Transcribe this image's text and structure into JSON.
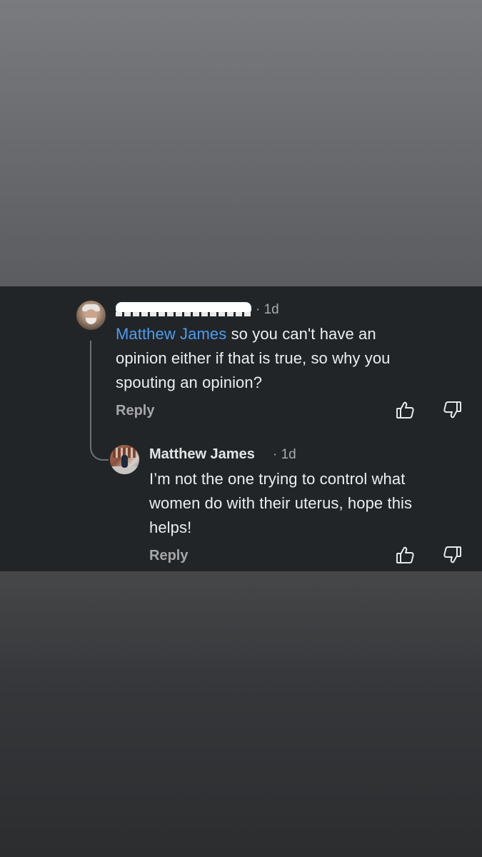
{
  "thread": {
    "comment1": {
      "time": "· 1d",
      "mention": "Matthew James",
      "line1_rest": " so you can't have an",
      "line2": "opinion either if that is true, so why you",
      "line3": "spouting an opinion?",
      "reply_label": "Reply"
    },
    "comment2": {
      "author": "Matthew James",
      "time": "· 1d",
      "line1": "I’m not the one trying to control what",
      "line2": "women do with their uterus, hope this",
      "line3": "helps!",
      "reply_label": "Reply"
    }
  },
  "icons": {
    "upvote": "thumbs-up-outline",
    "downvote": "thumbs-down-outline"
  },
  "colors": {
    "thread_bg": "#222527",
    "mention": "#4e9cf0",
    "text": "#eceeef",
    "meta": "#a7a9ab"
  }
}
